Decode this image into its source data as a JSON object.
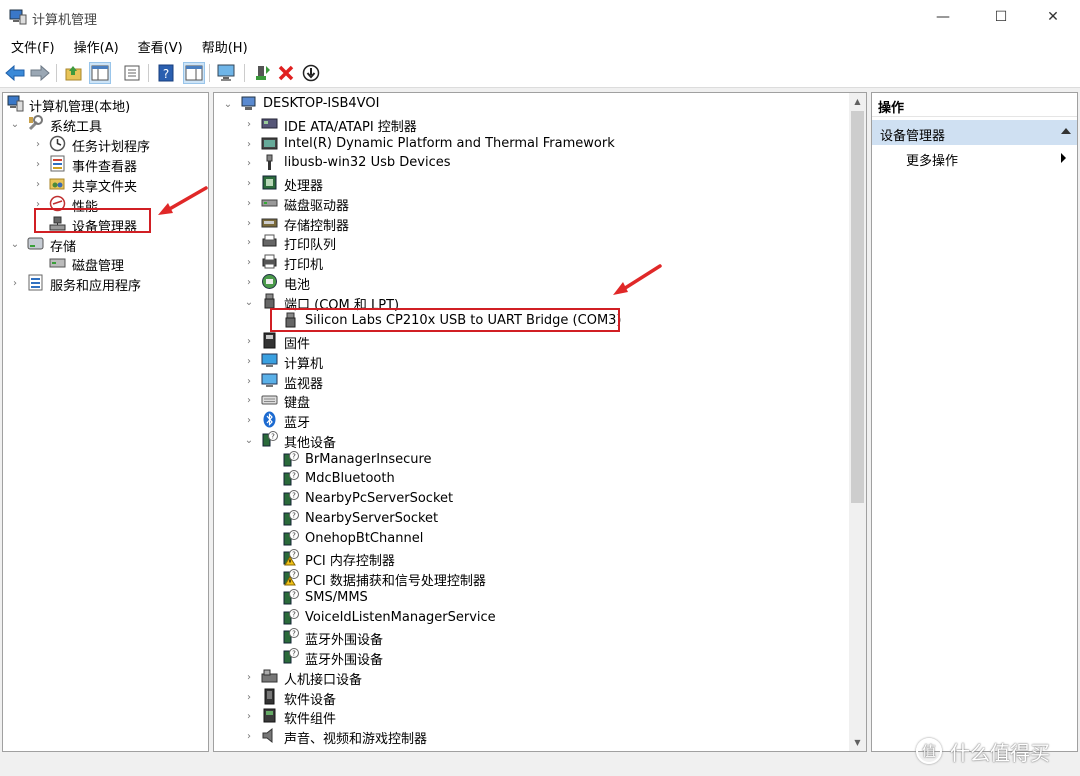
{
  "window": {
    "title": "计算机管理",
    "minimize": "—",
    "maximize": "☐",
    "close": "✕"
  },
  "menu": [
    "文件(F)",
    "操作(A)",
    "查看(V)",
    "帮助(H)"
  ],
  "toolbar": {
    "icons": [
      "back-icon",
      "forward-icon",
      "up-folder-icon",
      "show-tree-icon",
      "properties-icon",
      "help-icon",
      "view-icon",
      "monitor-icon",
      "update-driver-icon",
      "uninstall-icon",
      "disable-device-icon"
    ]
  },
  "left_tree": {
    "root": "计算机管理(本地)",
    "system_tools": "系统工具",
    "task_scheduler": "任务计划程序",
    "event_viewer": "事件查看器",
    "shared_folders": "共享文件夹",
    "performance": "性能",
    "device_manager": "设备管理器",
    "storage": "存储",
    "disk_management": "磁盘管理",
    "services_apps": "服务和应用程序"
  },
  "device_tree": {
    "root": "DESKTOP-ISB4VOI",
    "categories": [
      {
        "label": "IDE ATA/ATAPI 控制器",
        "icon": "ide-controller-icon"
      },
      {
        "label": "Intel(R) Dynamic Platform and Thermal Framework",
        "icon": "thermal-framework-icon"
      },
      {
        "label": "libusb-win32 Usb Devices",
        "icon": "usb-plug-icon"
      },
      {
        "label": "处理器",
        "icon": "processor-icon"
      },
      {
        "label": "磁盘驱动器",
        "icon": "disk-drive-icon"
      },
      {
        "label": "存储控制器",
        "icon": "storage-controller-icon"
      },
      {
        "label": "打印队列",
        "icon": "print-queue-icon"
      },
      {
        "label": "打印机",
        "icon": "printer-icon"
      },
      {
        "label": "电池",
        "icon": "battery-icon"
      }
    ],
    "ports": {
      "label": "端口 (COM 和 LPT)",
      "child": "Silicon Labs CP210x USB to UART Bridge (COM3)"
    },
    "categories2": [
      {
        "label": "固件",
        "icon": "firmware-icon"
      },
      {
        "label": "计算机",
        "icon": "computer-icon"
      },
      {
        "label": "监视器",
        "icon": "monitor-icon"
      },
      {
        "label": "键盘",
        "icon": "keyboard-icon"
      },
      {
        "label": "蓝牙",
        "icon": "bluetooth-icon"
      }
    ],
    "other": {
      "label": "其他设备",
      "children": [
        {
          "label": "BrManagerInsecure",
          "warn": false
        },
        {
          "label": "MdcBluetooth",
          "warn": false
        },
        {
          "label": "NearbyPcServerSocket",
          "warn": false
        },
        {
          "label": "NearbyServerSocket",
          "warn": false
        },
        {
          "label": "OnehopBtChannel",
          "warn": false
        },
        {
          "label": "PCI 内存控制器",
          "warn": true
        },
        {
          "label": "PCI 数据捕获和信号处理控制器",
          "warn": true
        },
        {
          "label": "SMS/MMS",
          "warn": false
        },
        {
          "label": "VoiceIdListenManagerService",
          "warn": false
        },
        {
          "label": "蓝牙外围设备",
          "warn": false
        },
        {
          "label": "蓝牙外围设备",
          "warn": false
        }
      ]
    },
    "categories3": [
      {
        "label": "人机接口设备",
        "icon": "hid-icon"
      },
      {
        "label": "软件设备",
        "icon": "software-device-icon"
      },
      {
        "label": "软件组件",
        "icon": "software-component-icon"
      },
      {
        "label": "声音、视频和游戏控制器",
        "icon": "sound-icon"
      }
    ]
  },
  "actions_pane": {
    "header": "操作",
    "section": "设备管理器",
    "more": "更多操作"
  },
  "watermark": "什么值得买",
  "colors": {
    "highlight_box": "#d11f24",
    "section_bg": "#cfe0f2"
  }
}
